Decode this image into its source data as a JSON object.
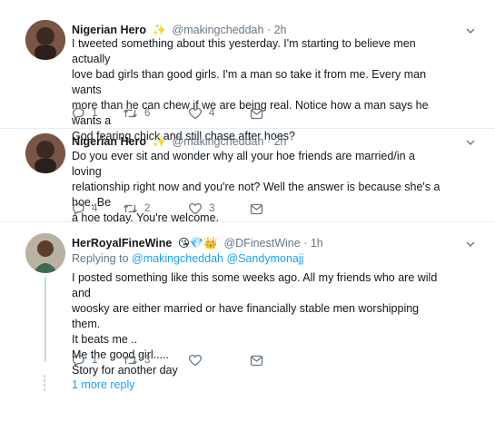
{
  "tweets": [
    {
      "name": "Nigerian Hero",
      "badge": "✨",
      "handle": "@makingcheddah",
      "time": "· 2h",
      "lines": [
        "I tweeted something about this yesterday. I'm starting to believe men actually",
        "love bad girls than good girls. I'm a man so take it from me. Every man wants",
        "more than he can chew if we are being real. Notice how a man says he wants a",
        "God fearing chick and still chase after hoes?"
      ],
      "replies": "1",
      "retweets": "6",
      "likes": "4"
    },
    {
      "name": "Nigerian Hero",
      "badge": "✨",
      "handle": "@makingcheddah",
      "time": "· 2h",
      "lines": [
        "Do you ever sit and wonder why all your hoe friends are married/in a loving",
        "relationship right now and you're not? Well the answer is because she's a hoe. Be",
        "a hoe today. You're welcome."
      ],
      "replies": "4",
      "retweets": "2",
      "likes": "3"
    },
    {
      "name": "HerRoyalFineWine",
      "badge": "😘💎👑",
      "handle": "@DFinestWine",
      "time": "· 1h",
      "replying_label": "Replying to",
      "replying_users": "@makingcheddah @Sandymonajj",
      "lines": [
        "I posted something like this some weeks ago. All my friends who are wild and",
        "woosky are either married or have financially stable men worshipping them.",
        "It beats me ..",
        "Me the good girl.....",
        "Story for another day"
      ],
      "replies": "1",
      "retweets": "3",
      "likes": ""
    }
  ],
  "more_replies": "1 more reply",
  "colors": {
    "link": "#1da1f2",
    "muted": "#657786",
    "divider": "#e6ecf0"
  },
  "icons": [
    "reply-icon",
    "retweet-icon",
    "like-icon",
    "dm-icon",
    "chevron-down-icon"
  ]
}
